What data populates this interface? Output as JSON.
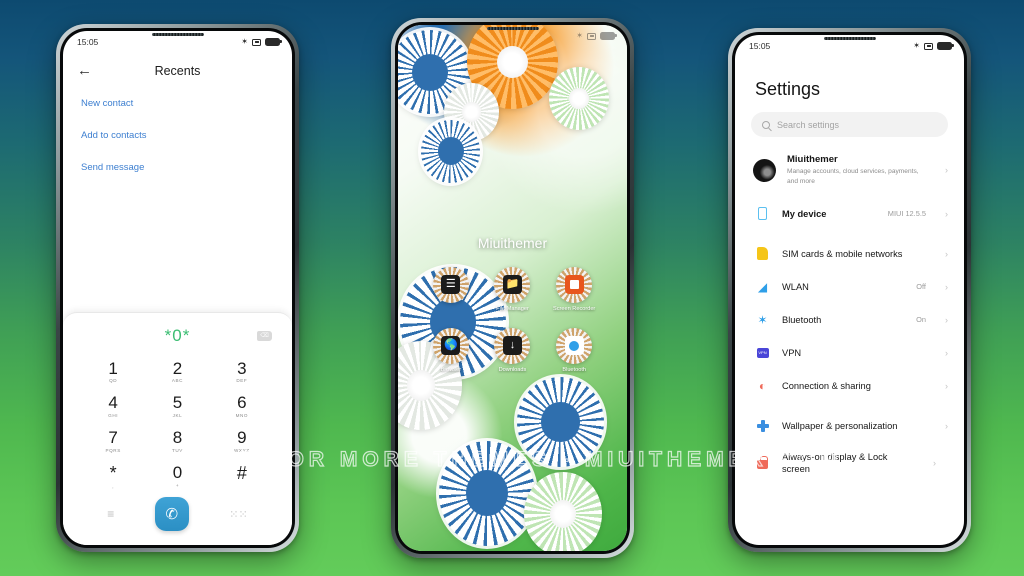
{
  "watermark": "VISIT FOR MORE THEMES - MIUITHEMER.COM",
  "background": {
    "top_color": "#0d4a70",
    "bottom_color": "#63cc5a"
  },
  "phones": {
    "left": {
      "name": "dialer-recents",
      "statusbar": {
        "time": "15:05",
        "icons": [
          "bluetooth-icon",
          "vibrate-icon",
          "battery-icon"
        ]
      },
      "header": {
        "back": "←",
        "title": "Recents"
      },
      "links": [
        {
          "label": "New contact"
        },
        {
          "label": "Add to contacts"
        },
        {
          "label": "Send message"
        }
      ],
      "dialer": {
        "entered_number": "*0*",
        "accent_color": "#3bbd72",
        "keys": [
          {
            "digit": "1",
            "sub": "QD"
          },
          {
            "digit": "2",
            "sub": "ABC"
          },
          {
            "digit": "3",
            "sub": "DEF"
          },
          {
            "digit": "4",
            "sub": "GHI"
          },
          {
            "digit": "5",
            "sub": "JKL"
          },
          {
            "digit": "6",
            "sub": "MNO"
          },
          {
            "digit": "7",
            "sub": "PQRS"
          },
          {
            "digit": "8",
            "sub": "TUV"
          },
          {
            "digit": "9",
            "sub": "WXYZ"
          },
          {
            "digit": "*",
            "sub": ","
          },
          {
            "digit": "0",
            "sub": "+"
          },
          {
            "digit": "#",
            "sub": ""
          }
        ],
        "bottom": {
          "list_icon": "≡",
          "call_icon": "✆",
          "keypad_icon": "∷"
        }
      }
    },
    "center": {
      "name": "home-screen",
      "statusbar": {
        "time": "",
        "icons": [
          "bluetooth-icon",
          "vibrate-icon",
          "battery-icon"
        ]
      },
      "wallpaper_label": "Miuithemer",
      "apps": [
        {
          "label": "",
          "icon": "chakra-icon"
        },
        {
          "label": "File Manager",
          "icon": "folder-icon"
        },
        {
          "label": "Screen Recorder",
          "icon": "record-icon"
        },
        {
          "label": "Browser",
          "icon": "globe-icon"
        },
        {
          "label": "Downloads",
          "icon": "download-icon"
        },
        {
          "label": "Bluetooth",
          "icon": "bluetooth-icon"
        }
      ]
    },
    "right": {
      "name": "settings",
      "statusbar": {
        "time": "15:05",
        "icons": [
          "bluetooth-icon",
          "vibrate-icon",
          "battery-icon"
        ]
      },
      "title": "Settings",
      "search": {
        "placeholder": "Search settings",
        "icon": "search-icon"
      },
      "profile": {
        "name": "Miuithemer",
        "subtitle": "Manage accounts, cloud services, payments, and more",
        "chevron": "›"
      },
      "items": [
        {
          "label": "My device",
          "value": "MIUI 12.5.5",
          "icon": "device-icon",
          "gap_after": true
        },
        {
          "label": "SIM cards & mobile networks",
          "value": "",
          "icon": "sim-icon"
        },
        {
          "label": "WLAN",
          "value": "Off",
          "icon": "wifi-icon"
        },
        {
          "label": "Bluetooth",
          "value": "On",
          "icon": "bluetooth-icon"
        },
        {
          "label": "VPN",
          "value": "",
          "icon": "vpn-icon"
        },
        {
          "label": "Connection & sharing",
          "value": "",
          "icon": "share-icon",
          "gap_after": true
        },
        {
          "label": "Wallpaper & personalization",
          "value": "",
          "icon": "wallpaper-icon"
        },
        {
          "label": "Always-on display & Lock screen",
          "value": "",
          "icon": "lock-icon"
        }
      ]
    }
  }
}
